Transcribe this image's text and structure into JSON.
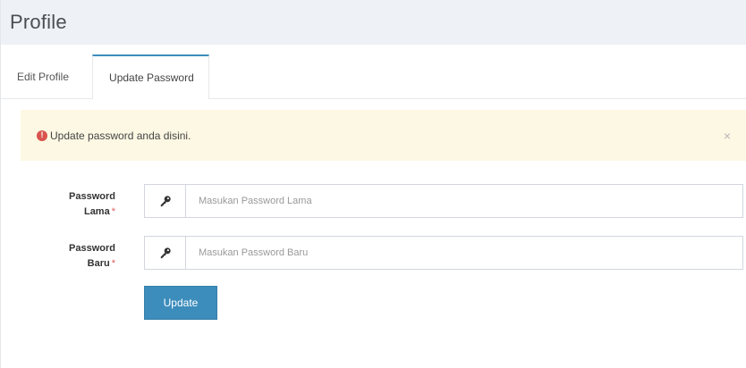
{
  "header": {
    "title": "Profile"
  },
  "tabs": [
    {
      "label": "Edit Profile",
      "active": false
    },
    {
      "label": "Update Password",
      "active": true
    }
  ],
  "alert": {
    "icon": "exclamation-circle-icon",
    "text": "Update password anda disini.",
    "close": "×",
    "background": "#fcf8e3",
    "icon_color": "#d9534f"
  },
  "form": {
    "fields": [
      {
        "label_line1": "Password",
        "label_line2": "Lama",
        "required_mark": "*",
        "icon": "key-icon",
        "placeholder": "Masukan Password Lama",
        "value": ""
      },
      {
        "label_line1": "Password",
        "label_line2": "Baru",
        "required_mark": "*",
        "icon": "key-icon",
        "placeholder": "Masukan Password Baru",
        "value": ""
      }
    ],
    "submit_label": "Update",
    "accent": "#3c8dbc"
  }
}
